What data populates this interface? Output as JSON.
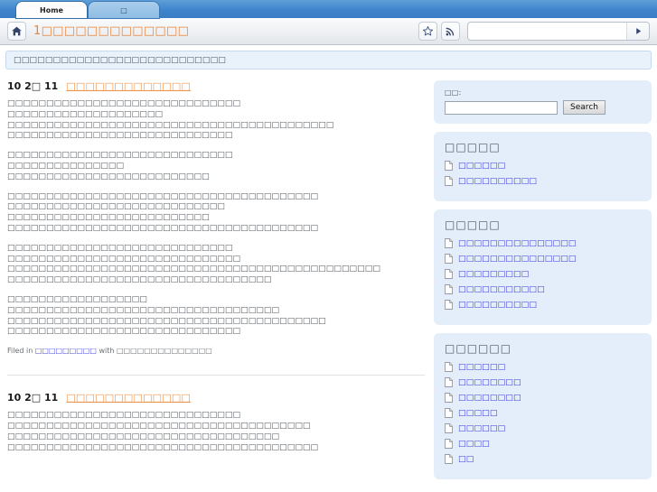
{
  "browser": {
    "tabs": [
      {
        "label": "Home",
        "active": true,
        "name": "tab-home"
      },
      {
        "label": "□",
        "active": false,
        "name": "tab-second"
      }
    ],
    "home_icon": "home-icon",
    "page_title": "1□□□□□□□□□□□□□",
    "star_icon": "star-icon",
    "rss_icon": "rss-icon",
    "url_value": "",
    "url_placeholder": "",
    "go_icon": "go-arrow-icon",
    "accent_blue": "#3f85cc",
    "title_orange": "#e8863c"
  },
  "notice": {
    "text": "□□□□□□□□□□□□□□□□□□□□□□□□□□□",
    "bg": "#e9f1fb"
  },
  "posts": [
    {
      "date": "10 2□ 11",
      "title": "□□□□□□□□□□□□□",
      "paragraphs": [
        [
          "□□□□□□□□□□□□□□□□□□□□□□□□□□□□□□",
          "□□□□□□□□□□□□□□□□□□□□",
          "□□□□□□□□□□□□□□□□□□□□□□□□□□□□□□□□□□□□□□□□□□",
          "□□□□□□□□□□□□□□□□□□□□□□□□□□□□□"
        ],
        [
          "□□□□□□□□□□□□□□□□□□□□□□□□□□□□□",
          "□□□□□□□□□□□□□□□",
          "□□□□□□□□□□□□□□□□□□□□□□□□□□"
        ],
        [
          "□□□□□□□□□□□□□□□□□□□□□□□□□□□□□□□□□□□□□□□□",
          "□□□□□□□□□□□□□□□□□□□□□□□□□□□□",
          "□□□□□□□□□□□□□□□□□□□□□□□□□□",
          "□□□□□□□□□□□□□□□□□□□□□□□□□□□□□□□□□□□□□□□□"
        ],
        [
          "□□□□□□□□□□□□□□□□□□□□□□□□□□□□□",
          "□□□□□□□□□□□□□□□□□□□□□□□□□□□□□□",
          "□□□□□□□□□□□□□□□□□□□□□□□□□□□□□□□□□□□□□□□□□□□□□□□□",
          "□□□□□□□□□□□□□□□□□□□□□□□□□□□□□□□□□□"
        ],
        [
          "□□□□□□□□□□□□□□□□□□",
          "□□□□□□□□□□□□□□□□□□□□□□□□□□□□□□□□□□□",
          "□□□□□□□□□□□□□□□□□□□□□□□□□□□□□□□□□□□□□□□□□",
          "□□□□□□□□□□□□□□□□□□□□□□□□□□□□□□"
        ]
      ],
      "filed_prefix": "Filed in",
      "filed_category": "□□□□□□□□□",
      "filed_with": "with",
      "filed_tags": "□□□□□□□□□□□□□□"
    },
    {
      "date": "10 2□ 11",
      "title": "□□□□□□□□□□□□□",
      "paragraphs": [
        [
          "□□□□□□□□□□□□□□□□□□□□□□□□□□□□□□",
          "□□□□□□□□□□□□□□□□□□□□□□□□□□□□□□□□□□□□□□□",
          "□□□□□□□□□□□□□□□□□□□□□□□□□□□□□□□□□□□",
          "□□□□□□□□□□□□□□□□□□□□□□□□□□□□□□□□□□□□□□□□"
        ]
      ],
      "filed_prefix": "",
      "filed_category": "",
      "filed_with": "",
      "filed_tags": ""
    }
  ],
  "sidebar": {
    "search": {
      "label": "□□:",
      "value": "",
      "placeholder": "",
      "button_label": "Search"
    },
    "widgets": [
      {
        "title": "□□□□□",
        "items": [
          "□□□□□□",
          "□□□□□□□□□□"
        ]
      },
      {
        "title": "□□□□□",
        "items": [
          "□□□□□□□□□□□□□□□",
          "□□□□□□□□□□□□□□□",
          "□□□□□□□□□",
          "□□□□□□□□□□□",
          "□□□□□□□□□□"
        ]
      },
      {
        "title": "□□□□□□",
        "items": [
          "□□□□□□",
          "□□□□□□□□",
          "□□□□□□□□",
          "□□□□□",
          "□□□□□□",
          "□□□□",
          "□□"
        ]
      }
    ],
    "doc_icon": "document-icon",
    "bg": "#e4eefb",
    "link_color": "#3b3bd8"
  }
}
